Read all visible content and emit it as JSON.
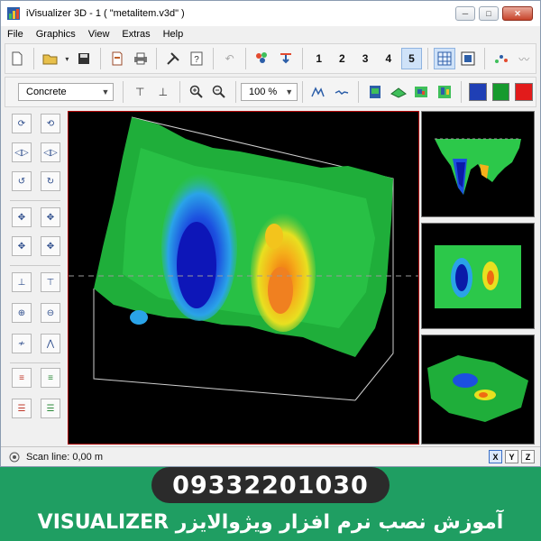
{
  "window": {
    "title": "iVisualizer 3D - 1 ( \"metalitem.v3d\" )",
    "controls": {
      "minimize": "─",
      "maximize": "□",
      "close": "✕"
    }
  },
  "menu": [
    "File",
    "Graphics",
    "View",
    "Extras",
    "Help"
  ],
  "toolbar1": {
    "icons": [
      "new-file-icon",
      "open-folder-icon",
      "save-icon",
      "properties-icon",
      "print-icon",
      "tools-icon",
      "help-icon",
      "undo-icon",
      "color-palette-icon",
      "arrow-down-icon"
    ],
    "view_numbers": [
      "1",
      "2",
      "3",
      "4",
      "5"
    ],
    "selected_view": "5"
  },
  "toolbar2": {
    "material": "Concrete",
    "zoom": "100 %",
    "colors": [
      "#1f3fb5",
      "#169a2e",
      "#e21b1b"
    ]
  },
  "status": {
    "scan_line": "Scan line: 0,00 m"
  },
  "axes": [
    "X",
    "Y",
    "Z"
  ],
  "selected_axis": "X",
  "banner": {
    "phone": "09332201030",
    "caption": "آموزش نصب نرم افزار ویژوالایزر VISUALIZER"
  }
}
